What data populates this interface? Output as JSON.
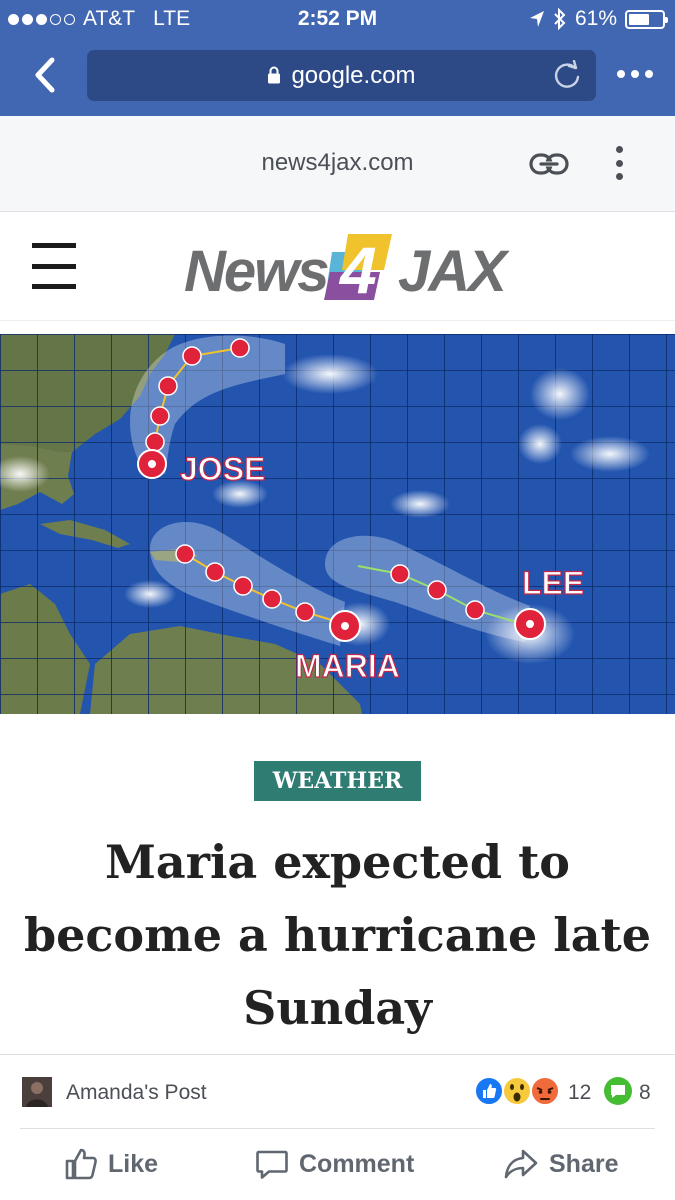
{
  "status_bar": {
    "carrier": "AT&T",
    "network": "LTE",
    "time": "2:52 PM",
    "battery": "61%",
    "battery_level": 0.61,
    "signal_bars": 3,
    "icons": [
      "location-arrow-icon",
      "bluetooth-icon",
      "battery-icon"
    ]
  },
  "browser": {
    "url": "google.com",
    "icons": [
      "back-chevron-icon",
      "lock-icon",
      "reload-icon",
      "more-dots-icon"
    ]
  },
  "page_header": {
    "domain": "news4jax.com",
    "icons": [
      "link-icon",
      "vertical-dots-icon"
    ]
  },
  "site": {
    "logo_text_left": "News",
    "logo_number": "4",
    "logo_text_right": "JAX"
  },
  "hero_map": {
    "storm_labels": [
      "JOSE",
      "MARIA",
      "LEE"
    ]
  },
  "article": {
    "category": "WEATHER",
    "headline": "Maria expected to become a hurricane late Sunday"
  },
  "post": {
    "author": "Amanda's Post",
    "reaction_count": "12",
    "comment_count": "8",
    "actions": {
      "like": "Like",
      "comment": "Comment",
      "share": "Share"
    }
  },
  "colors": {
    "chrome_blue": "#4267b2",
    "url_bar": "#2d4a86",
    "category_teal": "#2f7c72",
    "ocean": "#1f4fa8"
  }
}
